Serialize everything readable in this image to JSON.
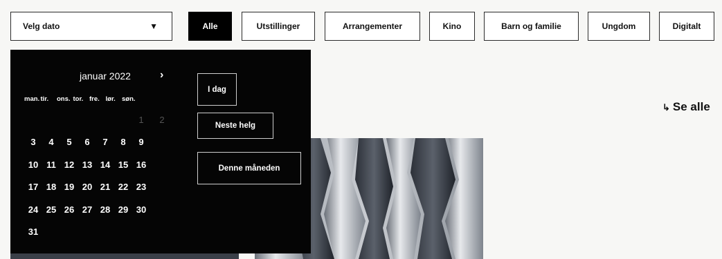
{
  "date_select": {
    "label": "Velg dato",
    "caret": "▼"
  },
  "filters": [
    {
      "label": "Alle",
      "active": true
    },
    {
      "label": "Utstillinger"
    },
    {
      "label": "Arrangementer"
    },
    {
      "label": "Kino"
    },
    {
      "label": "Barn og familie"
    },
    {
      "label": "Ungdom"
    },
    {
      "label": "Digitalt"
    }
  ],
  "see_all": {
    "arrow": "↳",
    "label": "Se alle"
  },
  "calendar": {
    "month": "januar 2022",
    "next_icon": "›",
    "weekdays": [
      "man.",
      "tir.",
      "ons.",
      "tor.",
      "fre.",
      "lør.",
      "søn."
    ],
    "days_muted": [
      "1",
      "2"
    ],
    "weeks": [
      [
        "3",
        "4",
        "5",
        "6",
        "7",
        "8",
        "9"
      ],
      [
        "10",
        "11",
        "12",
        "13",
        "14",
        "15",
        "16"
      ],
      [
        "17",
        "18",
        "19",
        "20",
        "21",
        "22",
        "23"
      ],
      [
        "24",
        "25",
        "26",
        "27",
        "28",
        "29",
        "30"
      ],
      [
        "31"
      ]
    ]
  },
  "quick_ranges": [
    "I dag",
    "Neste helg",
    "Denne måneden"
  ],
  "colors": {
    "popup_bg": "#050505",
    "accent": "#000000",
    "page_bg": "#f7f7f5"
  }
}
